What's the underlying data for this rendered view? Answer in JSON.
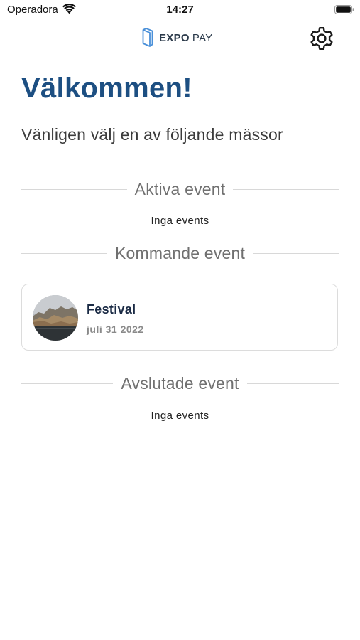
{
  "status_bar": {
    "carrier": "Operadora",
    "time": "14:27"
  },
  "header": {
    "logo_bold": "EXPO",
    "logo_light": "PAY",
    "settings_icon": "gear-icon"
  },
  "main": {
    "title": "Välkommen!",
    "subtitle": "Vänligen välj en av följande mässor"
  },
  "sections": {
    "active": {
      "label": "Aktiva event",
      "empty_text": "Inga events"
    },
    "upcoming": {
      "label": "Kommande event",
      "events": [
        {
          "name": "Festival",
          "date": "juli 31 2022"
        }
      ]
    },
    "finished": {
      "label": "Avslutade event",
      "empty_text": "Inga events"
    }
  },
  "colors": {
    "title": "#1d4f82",
    "logo_accent": "#4a90d9",
    "event_name": "#1b2b45",
    "event_date": "#8a8a8a",
    "divider": "#d8d8d8"
  }
}
